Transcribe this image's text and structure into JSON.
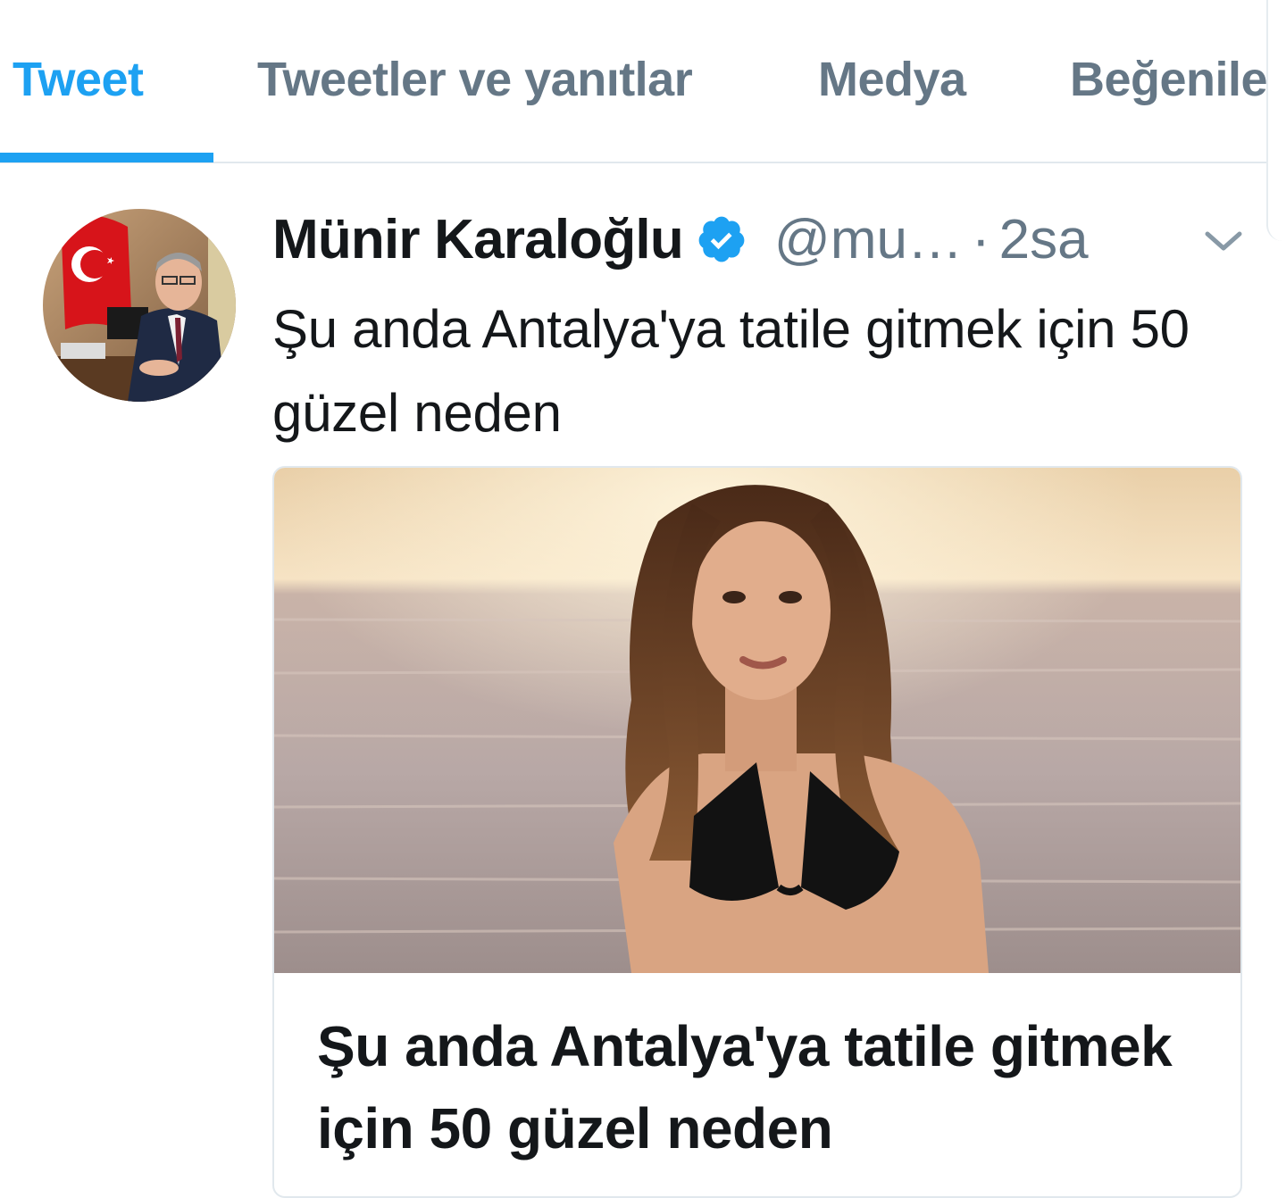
{
  "tabs": [
    {
      "label": "Tweet",
      "active": true
    },
    {
      "label": "Tweetler ve yanıtlar",
      "active": false
    },
    {
      "label": "Medya",
      "active": false
    },
    {
      "label": "Beğeniler",
      "active": false
    }
  ],
  "tweet": {
    "author_name": "Münir Karaloğlu",
    "handle": "@mu…",
    "separator": "·",
    "time": "2sa",
    "text": "Şu anda Antalya'ya tatile gitmek için 50 güzel neden",
    "verified": true
  },
  "card": {
    "title": "Şu anda Antalya'ya tatile gitmek için 50 güzel neden"
  },
  "icons": {
    "verified": "verified-badge-icon",
    "menu": "chevron-down-icon"
  },
  "colors": {
    "accent": "#1da1f2",
    "secondary_text": "#657786",
    "primary_text": "#14171a",
    "border": "#e1e8ed"
  }
}
